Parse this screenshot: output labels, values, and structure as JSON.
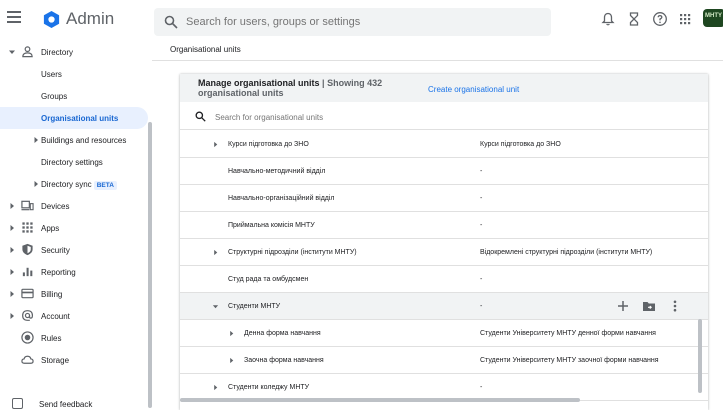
{
  "app": {
    "title": "Admin",
    "avatar_text": "MHTY"
  },
  "search": {
    "placeholder": "Search for users, groups or settings"
  },
  "sidebar": {
    "directory": "Directory",
    "users": "Users",
    "groups": "Groups",
    "org_units": "Organisational units",
    "buildings": "Buildings and resources",
    "dir_settings": "Directory settings",
    "dir_sync": "Directory sync",
    "beta": "BETA",
    "devices": "Devices",
    "apps": "Apps",
    "security": "Security",
    "reporting": "Reporting",
    "billing": "Billing",
    "account": "Account",
    "rules": "Rules",
    "storage": "Storage",
    "feedback": "Send feedback"
  },
  "breadcrumb": "Organisational units",
  "card": {
    "title": "Manage organisational units",
    "separator": "|",
    "count": "Showing 432 organisational units",
    "create": "Create organisational unit",
    "search_placeholder": "Search for organisational units"
  },
  "rows": [
    {
      "name": "Курси підготовка до ЗНО",
      "desc": "Курси підготовка до ЗНО"
    },
    {
      "name": "Навчально-методичний відділ",
      "desc": "-"
    },
    {
      "name": "Навчально-організаційний відділ",
      "desc": "-"
    },
    {
      "name": "Приймальна комісія МНТУ",
      "desc": "-"
    },
    {
      "name": "Структурні підрозділи (інститути МНТУ)",
      "desc": "Відокремлені структурні підрозділи (інститути МНТУ)"
    },
    {
      "name": "Студ рада та омбудсмен",
      "desc": "-"
    },
    {
      "name": "Студенти МНТУ",
      "desc": "-"
    },
    {
      "name": "Денна форма навчання",
      "desc": "Студенти Університету МНТУ денної форми навчання"
    },
    {
      "name": "Заочна форма навчання",
      "desc": "Студенти Університету МНТУ заочної форми навчання"
    },
    {
      "name": "Студенти коледжу МНТУ",
      "desc": "-"
    }
  ],
  "colors": {
    "accent": "#1a73e8",
    "active_bg": "#e8f0fe",
    "header_bg": "#f1f3f4"
  }
}
